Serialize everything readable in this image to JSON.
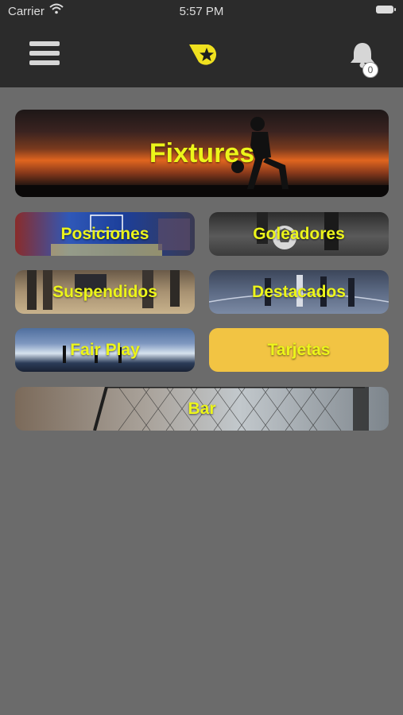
{
  "status_bar": {
    "carrier": "Carrier",
    "time": "5:57 PM"
  },
  "nav": {
    "notification_count": "0"
  },
  "tiles": {
    "fixtures": "Fixtures",
    "posiciones": "Posiciones",
    "goleadores": "Goleadores",
    "suspendidos": "Suspendidos",
    "destacados": "Destacados",
    "fair_play": "Fair Play",
    "tarjetas": "Tarjetas",
    "bar": "Bar"
  },
  "colors": {
    "label": "#ecf51a",
    "tarjetas_bg": "#f2c443",
    "logo": "#f0e11f",
    "background": "#6b6b6b",
    "nav_bg": "#2b2b2b"
  },
  "icons": [
    "menu-icon",
    "star-logo-icon",
    "bell-icon",
    "wifi-icon",
    "battery-icon"
  ]
}
